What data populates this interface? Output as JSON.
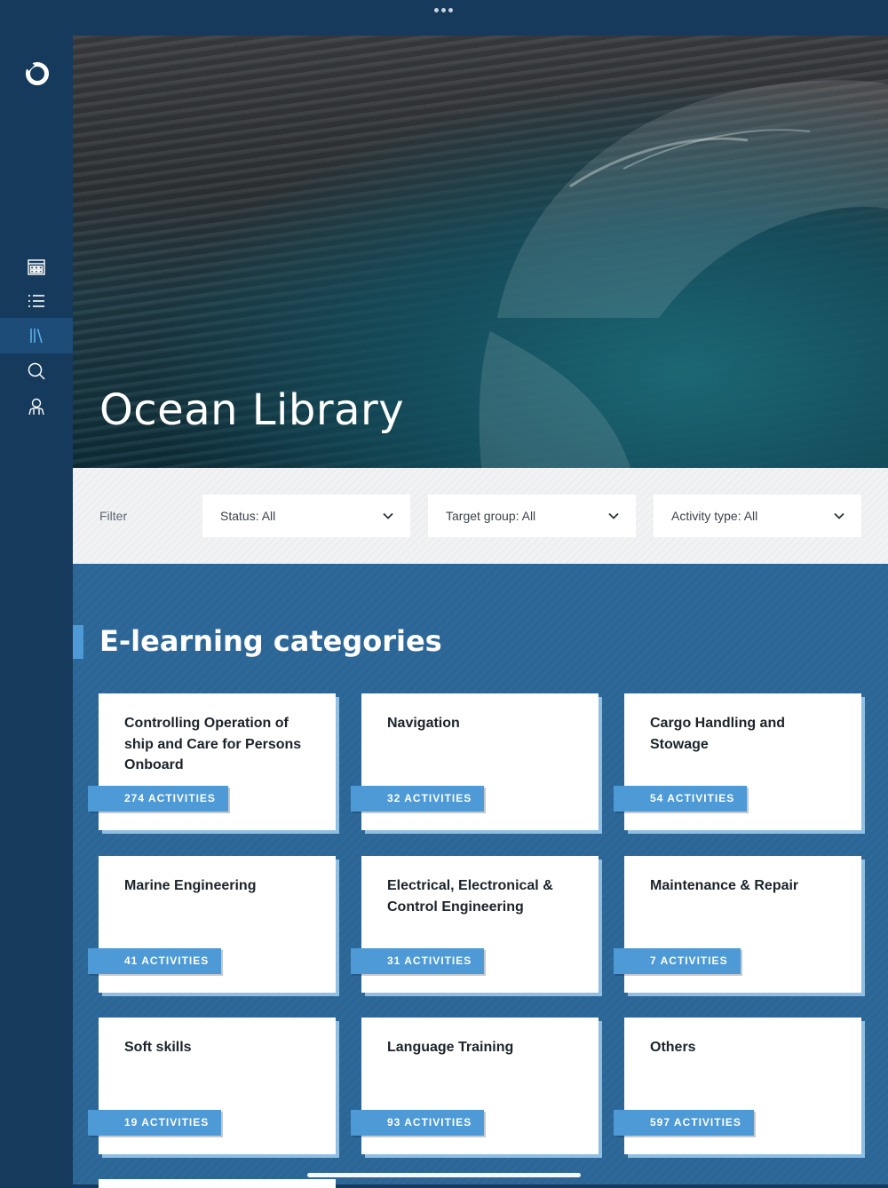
{
  "app": {
    "title": "Ocean Library",
    "colors": {
      "sidebar": "#163a5c",
      "content_bg": "#2b6697",
      "accent": "#4e9ad6",
      "filter_bg": "#f1f2f4"
    }
  },
  "sidebar": {
    "logo_icon": "ring-logo-icon",
    "items": [
      {
        "id": "dashboard",
        "icon": "dashboard-icon",
        "active": false
      },
      {
        "id": "list",
        "icon": "list-icon",
        "active": false
      },
      {
        "id": "library",
        "icon": "library-icon",
        "active": true
      },
      {
        "id": "search",
        "icon": "search-icon",
        "active": false
      },
      {
        "id": "profile",
        "icon": "user-icon",
        "active": false
      }
    ]
  },
  "hero": {
    "title": "Ocean Library"
  },
  "filter": {
    "label": "Filter",
    "selects": [
      {
        "value": "Status: All",
        "icon": "chevron-down-icon"
      },
      {
        "value": "Target group: All",
        "icon": "chevron-down-icon"
      },
      {
        "value": "Activity type: All",
        "icon": "chevron-down-icon"
      }
    ]
  },
  "section": {
    "title": "E-learning categories"
  },
  "categories": [
    {
      "title": "Controlling Operation of ship and Care for Persons Onboard",
      "count": "274 ACTIVITIES"
    },
    {
      "title": "Navigation",
      "count": "32 ACTIVITIES"
    },
    {
      "title": "Cargo Handling and Stowage",
      "count": "54 ACTIVITIES"
    },
    {
      "title": "Marine Engineering",
      "count": "41 ACTIVITIES"
    },
    {
      "title": "Electrical, Electronical & Control Engineering",
      "count": "31 ACTIVITIES"
    },
    {
      "title": "Maintenance & Repair",
      "count": "7 ACTIVITIES"
    },
    {
      "title": "Soft skills",
      "count": "19 ACTIVITIES"
    },
    {
      "title": "Language Training",
      "count": "93 ACTIVITIES"
    },
    {
      "title": "Others",
      "count": "597 ACTIVITIES"
    }
  ]
}
